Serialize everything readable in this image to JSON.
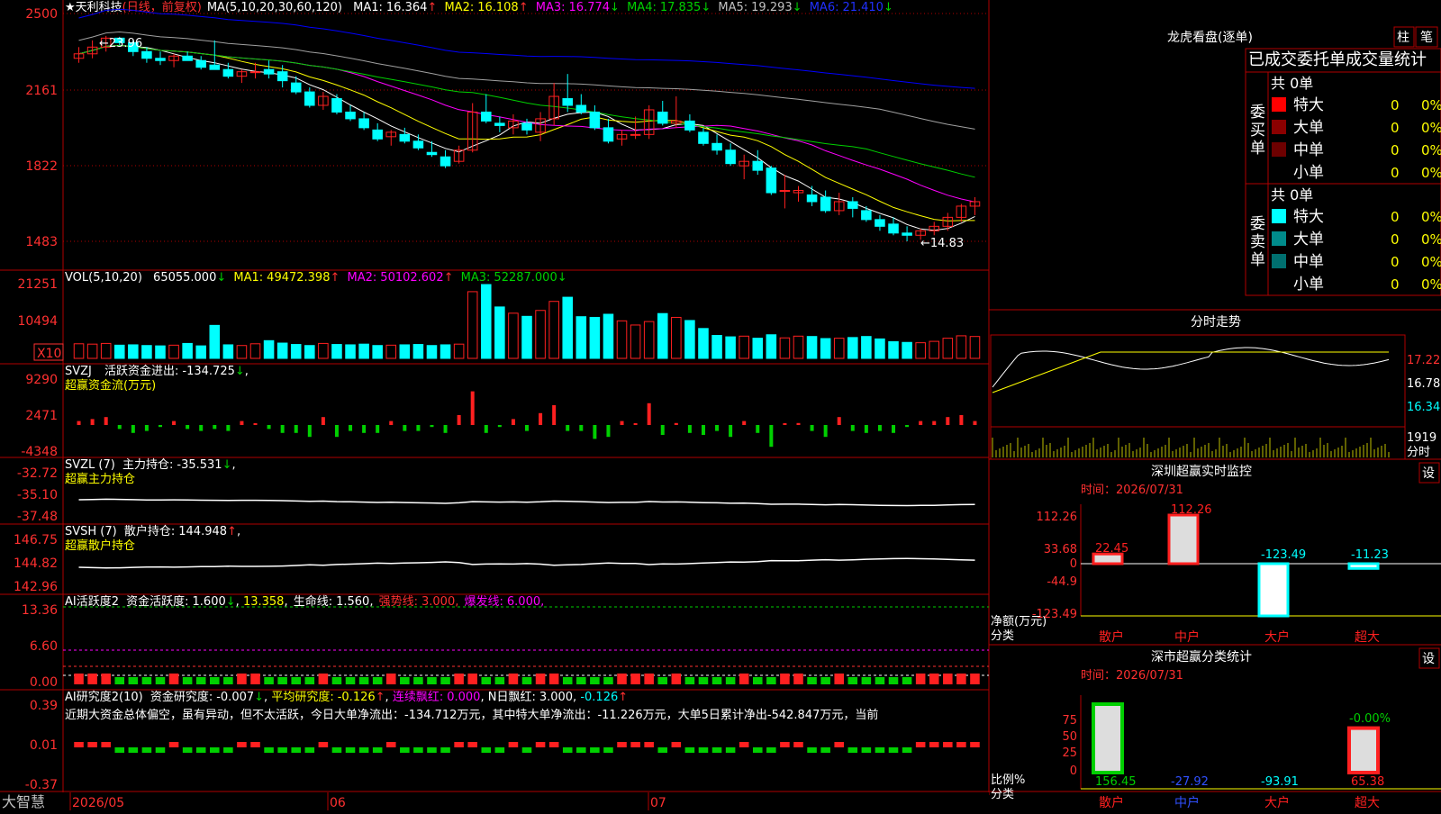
{
  "colors": {
    "up": "#ff2020",
    "down": "#00ffff",
    "grid": "#b00000",
    "text": "#c0c0c0",
    "white": "#ffffff",
    "yellow": "#ffff00",
    "magenta": "#ff00ff",
    "green": "#00d000",
    "blue": "#0000ff",
    "gray": "#a0a0a0"
  },
  "header": {
    "star": "★",
    "stock": "天利科技",
    "period": "(日线，前复权)",
    "ma_params": "MA(5,10,20,30,60,120)",
    "ma": [
      {
        "label": "MA1:",
        "value": "16.364",
        "arrow": "↑",
        "color": "#ffffff"
      },
      {
        "label": "MA2:",
        "value": "16.108",
        "arrow": "↑",
        "color": "#ffff00"
      },
      {
        "label": "MA3:",
        "value": "16.774",
        "arrow": "↓",
        "color": "#ff00ff"
      },
      {
        "label": "MA4:",
        "value": "17.835",
        "arrow": "↓",
        "color": "#00d000"
      },
      {
        "label": "MA5:",
        "value": "19.293",
        "arrow": "↓",
        "color": "#c0c0c0"
      },
      {
        "label": "MA6:",
        "value": "21.410",
        "arrow": "↓",
        "color": "#0000ff"
      }
    ],
    "high_note": "←23.96",
    "low_note": "←14.83"
  },
  "left_axis": {
    "price": [
      "2500",
      "2161",
      "1822",
      "1483"
    ],
    "vol": [
      "21251",
      "10494"
    ],
    "vol_unit": "X10",
    "svzj": [
      "9290",
      "2471",
      "-4348"
    ],
    "svzl": [
      "-32.72",
      "-35.10",
      "-37.48"
    ],
    "svsh": [
      "146.75",
      "144.82",
      "142.96"
    ],
    "ai1": [
      "13.36",
      "6.60",
      "0.00"
    ],
    "ai2": [
      "0.39",
      "0.01",
      "-0.37"
    ]
  },
  "panels": {
    "vol": {
      "params": "VOL(5,10,20)",
      "value": "65055.000",
      "arrow": "↓",
      "ma1": "49472.398",
      "ma1_arrow": "↑",
      "ma2": "50102.602",
      "ma2_arrow": "↑",
      "ma3": "52287.000",
      "ma3_arrow": "↓"
    },
    "svzj": {
      "params": "SVZJ",
      "label": "活跃资金进出:",
      "value": "-134.725",
      "arrow": "↓",
      "sub": "超赢资金流(万元)"
    },
    "svzl": {
      "params": "SVZL (7)",
      "label": "主力持仓:",
      "value": "-35.531",
      "arrow": "↓",
      "sub": "超赢主力持仓"
    },
    "svsh": {
      "params": "SVSH (7)",
      "label": "散户持仓:",
      "value": "144.948",
      "arrow": "↑",
      "sub": "超赢散户持仓"
    },
    "ai1": {
      "params": "AI活跃度2",
      "l1": "资金活跃度:",
      "v1": "1.600",
      "a1": "↓",
      "v2": "13.358",
      "l3": "生命线:",
      "v3": "1.560",
      "l4": "强势线:",
      "v4": "3.000",
      "l5": "爆发线:",
      "v5": "6.000"
    },
    "ai2": {
      "params": "AI研究度2(10)",
      "l1": "资金研究度:",
      "v1": "-0.007",
      "a1": "↓",
      "l2": "平均研究度:",
      "v2": "-0.126",
      "a2": "↑",
      "l3": "连续飘红:",
      "v3": "0.000",
      "l4": "N日飘红:",
      "v4": "3.000",
      "v5": "-0.126",
      "a5": "↑",
      "note": "近期大资金总体偏空，虽有异动，但不太活跃，今日大单净流出：-134.712万元，其中特大单净流出：-11.226万元，大单5日累计净出-542.847万元，当前"
    }
  },
  "xaxis": {
    "brand": "大智慧",
    "m1": "2026/05",
    "m2": "06",
    "m3": "07"
  },
  "right": {
    "lhkp_title": "龙虎看盘(逐单)",
    "btn_zhu": "柱",
    "btn_bi": "笔",
    "table_title": "已成交委托单成交量统计",
    "buy_label": "委买单",
    "sell_label": "委卖单",
    "total": "共 0单",
    "rows": [
      "特大",
      "大单",
      "中单",
      "小单"
    ],
    "row_value": "0",
    "row_pct": "0%",
    "buy_colors": [
      "#ff0000",
      "#8b0000",
      "#6e0000",
      "#000000"
    ],
    "sell_colors": [
      "#00ffff",
      "#008b8b",
      "#007070",
      "#000000"
    ],
    "fenshi_title": "分时走势",
    "fenshi_axis": [
      "17.22",
      "16.78",
      "16.34",
      "1919"
    ],
    "fenshi_unit": "分时",
    "sz_title": "深圳超赢实时监控",
    "set": "设",
    "time": "时间：2026/07/31",
    "sz_axis": [
      "112.26",
      "33.68",
      "0",
      "-44.9",
      "-123.49"
    ],
    "sz_unit": "净额(万元)",
    "cat_label": "分类",
    "cats": [
      "散户",
      "中户",
      "大户",
      "超大"
    ],
    "sz_values": [
      22.45,
      112.26,
      -123.49,
      -11.23
    ],
    "sz_value_text": [
      "22.45",
      "112.26",
      "-123.49",
      "-11.23"
    ],
    "ss_title": "深市超赢分类统计",
    "ss_axis": [
      "75",
      "50",
      "25",
      "0"
    ],
    "ss_unit": "比例%",
    "ss_top_note": "-0.00%",
    "ss_values": [
      156.45,
      -27.92,
      -93.91,
      65.38
    ],
    "ss_value_text": [
      "156.45",
      "-27.92",
      "-93.91",
      "65.38"
    ],
    "ss_bars": [
      100,
      0,
      0,
      65
    ]
  },
  "chart_data": [
    {
      "type": "candlestick",
      "title": "天利科技 (日线，前复权)",
      "ylim": [
        14.5,
        25.0
      ],
      "x_ticks": [
        "2026/05",
        "06",
        "07"
      ],
      "ohlc": [
        [
          23.0,
          23.5,
          22.8,
          23.2
        ],
        [
          23.2,
          23.8,
          23.0,
          23.5
        ],
        [
          23.5,
          24.0,
          23.3,
          23.9
        ],
        [
          23.9,
          23.96,
          23.6,
          23.7
        ],
        [
          23.7,
          23.8,
          23.1,
          23.3
        ],
        [
          23.3,
          23.5,
          22.8,
          23.0
        ],
        [
          23.0,
          23.3,
          22.7,
          22.9
        ],
        [
          22.9,
          23.2,
          22.6,
          23.1
        ],
        [
          23.1,
          23.3,
          22.9,
          22.9
        ],
        [
          22.9,
          23.1,
          22.5,
          22.6
        ],
        [
          22.7,
          23.8,
          22.5,
          22.5
        ],
        [
          22.5,
          22.8,
          22.1,
          22.2
        ],
        [
          22.2,
          22.5,
          21.9,
          22.4
        ],
        [
          22.4,
          22.8,
          22.1,
          22.4
        ],
        [
          22.5,
          22.9,
          22.1,
          22.3
        ],
        [
          22.4,
          22.7,
          21.7,
          22.0
        ],
        [
          21.9,
          22.2,
          21.4,
          21.5
        ],
        [
          21.5,
          21.7,
          20.8,
          20.9
        ],
        [
          20.9,
          21.5,
          20.7,
          21.3
        ],
        [
          21.2,
          21.4,
          20.5,
          20.6
        ],
        [
          20.6,
          20.9,
          20.2,
          20.3
        ],
        [
          20.3,
          20.6,
          19.8,
          19.9
        ],
        [
          19.8,
          20.1,
          19.3,
          19.4
        ],
        [
          19.5,
          19.8,
          19.1,
          19.7
        ],
        [
          19.6,
          19.9,
          19.2,
          19.3
        ],
        [
          19.3,
          19.6,
          18.9,
          19.0
        ],
        [
          18.8,
          19.3,
          18.6,
          18.7
        ],
        [
          18.6,
          18.9,
          18.1,
          18.2
        ],
        [
          18.4,
          19.1,
          18.3,
          18.9
        ],
        [
          18.9,
          21.0,
          18.8,
          20.6
        ],
        [
          20.6,
          21.4,
          20.1,
          20.2
        ],
        [
          20.1,
          20.4,
          19.7,
          20.0
        ],
        [
          19.9,
          20.5,
          19.6,
          20.2
        ],
        [
          20.1,
          20.3,
          19.6,
          19.8
        ],
        [
          19.7,
          20.6,
          19.3,
          20.3
        ],
        [
          20.3,
          21.9,
          20.0,
          21.3
        ],
        [
          21.2,
          22.3,
          20.6,
          20.9
        ],
        [
          20.9,
          21.4,
          20.5,
          20.6
        ],
        [
          20.6,
          20.9,
          19.8,
          19.9
        ],
        [
          19.9,
          20.3,
          19.2,
          19.3
        ],
        [
          19.4,
          19.8,
          19.1,
          19.6
        ],
        [
          19.6,
          20.4,
          19.4,
          19.6
        ],
        [
          19.6,
          20.9,
          19.4,
          20.7
        ],
        [
          20.6,
          21.1,
          20.0,
          20.1
        ],
        [
          20.1,
          21.3,
          19.9,
          20.2
        ],
        [
          20.2,
          20.5,
          19.7,
          19.8
        ],
        [
          19.7,
          19.9,
          19.1,
          19.2
        ],
        [
          19.2,
          19.6,
          18.7,
          18.9
        ],
        [
          18.9,
          19.2,
          18.2,
          18.3
        ],
        [
          18.2,
          18.7,
          17.6,
          18.4
        ],
        [
          18.4,
          18.9,
          17.8,
          18.0
        ],
        [
          18.1,
          18.2,
          16.9,
          17.0
        ],
        [
          17.1,
          17.8,
          16.3,
          17.1
        ],
        [
          17.0,
          17.3,
          16.6,
          17.1
        ],
        [
          16.9,
          17.3,
          16.4,
          16.6
        ],
        [
          16.8,
          17.1,
          16.1,
          16.2
        ],
        [
          16.2,
          17.0,
          16.0,
          16.6
        ],
        [
          16.6,
          16.8,
          15.9,
          16.3
        ],
        [
          16.2,
          16.4,
          15.7,
          15.8
        ],
        [
          15.8,
          16.0,
          15.3,
          15.5
        ],
        [
          15.6,
          15.9,
          15.1,
          15.2
        ],
        [
          15.2,
          15.5,
          14.83,
          15.1
        ],
        [
          15.1,
          15.4,
          14.9,
          15.3
        ],
        [
          15.3,
          15.7,
          15.1,
          15.5
        ],
        [
          15.5,
          16.1,
          15.3,
          15.9
        ],
        [
          15.9,
          16.5,
          15.7,
          16.4
        ],
        [
          16.4,
          16.8,
          16.0,
          16.6
        ]
      ],
      "ma_series": [
        "MA1",
        "MA2",
        "MA3",
        "MA4",
        "MA5",
        "MA6"
      ],
      "ma_values": [
        16.364,
        16.108,
        16.774,
        17.835,
        19.293,
        21.41
      ]
    },
    {
      "type": "bar",
      "title": "VOL(5,10,20)",
      "ylim": [
        0,
        21251
      ],
      "values": [
        4200,
        4100,
        4300,
        3800,
        3900,
        3700,
        3600,
        3800,
        4300,
        3600,
        9500,
        3900,
        3700,
        4200,
        5100,
        4400,
        4000,
        3700,
        4300,
        4000,
        3900,
        4100,
        3700,
        3800,
        3900,
        4000,
        3700,
        3900,
        4100,
        19200,
        21251,
        14800,
        13000,
        12100,
        13800,
        16400,
        17600,
        12000,
        11800,
        12700,
        10800,
        9600,
        10600,
        12900,
        11800,
        10900,
        8600,
        6600,
        6200,
        6400,
        5800,
        6800,
        5900,
        6400,
        6300,
        5700,
        5800,
        6000,
        6300,
        5600,
        4800,
        4600,
        4500,
        4900,
        5800,
        6500,
        6300
      ]
    },
    {
      "type": "bar",
      "title": "SVZJ 活跃资金进出",
      "ylim": [
        -4348,
        9290
      ],
      "values": [
        0,
        0,
        0,
        0,
        0,
        0,
        0,
        0,
        0,
        0,
        0,
        0,
        0,
        0,
        0,
        0,
        0,
        0,
        0,
        0,
        0,
        0,
        0,
        0,
        0,
        0,
        0,
        0,
        0,
        0,
        0,
        0,
        0,
        0,
        0,
        0,
        0,
        0,
        0,
        0,
        0,
        0,
        0,
        0,
        0,
        0,
        0,
        0,
        0,
        0,
        0,
        0,
        0,
        0,
        0,
        0,
        0,
        0,
        0,
        0,
        0,
        0,
        0,
        0,
        0,
        0,
        0
      ]
    }
  ]
}
